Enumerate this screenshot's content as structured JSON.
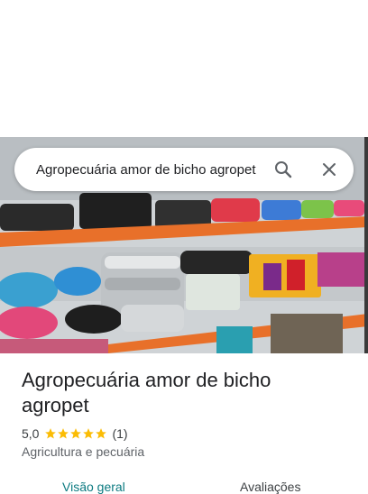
{
  "search": {
    "query": "Agropecuária amor de bicho agropet",
    "search_icon": "search-icon",
    "close_icon": "close-icon"
  },
  "place": {
    "name": "Agropecuária amor de bicho agropet",
    "rating": "5,0",
    "stars": 5,
    "review_count": "(1)",
    "category": "Agricultura e pecuária"
  },
  "tabs": [
    {
      "label": "Visão geral",
      "active": true
    },
    {
      "label": "Avaliações",
      "active": false
    }
  ],
  "colors": {
    "star": "#fbbc04",
    "active_tab": "#0b7a80",
    "shelf": "#e8702a"
  }
}
